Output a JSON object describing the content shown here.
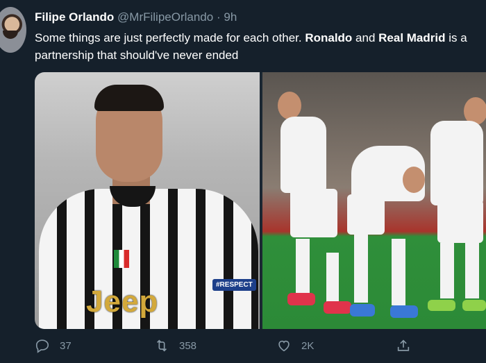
{
  "tweet": {
    "name": "Filipe Orlando",
    "handle": "@MrFilipeOrlando",
    "separator": "·",
    "time": "9h",
    "text_part1": "Some things are just perfectly made for each other. ",
    "text_bold1": "Ronaldo",
    "text_part2": " and ",
    "text_bold2": "Real Madrid",
    "text_part3": " is a partnership that should've never ended"
  },
  "media": {
    "left": {
      "sponsor": "Jeep",
      "sleeve_badge": "#RESPECT"
    }
  },
  "actions": {
    "reply_count": "37",
    "retweet_count": "358",
    "like_count": "2K"
  },
  "icons": {
    "reply": "reply-icon",
    "retweet": "retweet-icon",
    "like": "heart-icon",
    "share": "share-icon"
  },
  "colors": {
    "background": "#15202b",
    "secondary_text": "#8899a6"
  }
}
